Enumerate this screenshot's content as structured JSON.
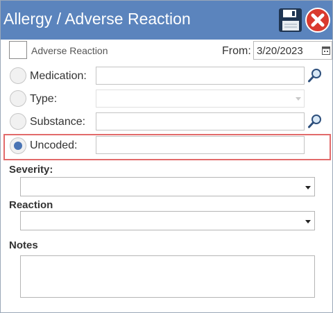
{
  "window": {
    "title": "Allergy / Adverse Reaction",
    "title_bar_color": "#5b84bd",
    "save_icon": "floppy-disk-icon",
    "close_icon": "close-icon"
  },
  "adverse": {
    "label": "Adverse Reaction",
    "checked": false
  },
  "from": {
    "label": "From:",
    "value": "3/20/2023",
    "icon": "calendar-icon"
  },
  "source": {
    "selected": "Uncoded",
    "rows": {
      "medication": {
        "label": "Medication:",
        "value": "",
        "icon": "search-icon"
      },
      "type": {
        "label": "Type:",
        "value": ""
      },
      "substance": {
        "label": "Substance:",
        "value": "",
        "icon": "search-icon"
      },
      "uncoded": {
        "label": "Uncoded:",
        "value": ""
      }
    }
  },
  "severity": {
    "label": "Severity:",
    "value": ""
  },
  "reaction": {
    "label": "Reaction",
    "value": ""
  },
  "notes": {
    "label": "Notes",
    "value": ""
  },
  "colors": {
    "accent": "#4a74b4",
    "highlight": "#e26a6a",
    "close_red": "#d93a2e"
  }
}
